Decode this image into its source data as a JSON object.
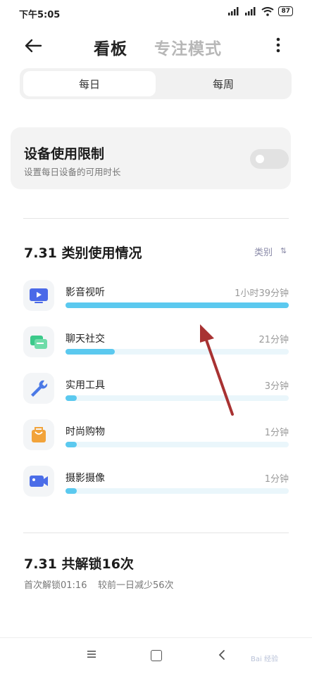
{
  "status_bar": {
    "time": "下午5:05",
    "battery": "87"
  },
  "header": {
    "tab_active": "看板",
    "tab_inactive": "专注模式"
  },
  "segment": {
    "daily": "每日",
    "weekly": "每周"
  },
  "limit_card": {
    "title": "设备使用限制",
    "subtitle": "设置每日设备的可用时长",
    "toggle_on": false
  },
  "category_section": {
    "title": "7.31 类别使用情况",
    "sort_label": "类别",
    "items": [
      {
        "name": "影音视听",
        "time": "1小时39分钟",
        "progress": 1.0,
        "icon": "video-icon",
        "color": "#4a69e8"
      },
      {
        "name": "聊天社交",
        "time": "21分钟",
        "progress": 0.22,
        "icon": "chat-icon",
        "color": "#3bc98a"
      },
      {
        "name": "实用工具",
        "time": "3分钟",
        "progress": 0.05,
        "icon": "wrench-icon",
        "color": "#4b79e6"
      },
      {
        "name": "时尚购物",
        "time": "1分钟",
        "progress": 0.05,
        "icon": "shopping-bag-icon",
        "color": "#f2a33a"
      },
      {
        "name": "摄影摄像",
        "time": "1分钟",
        "progress": 0.05,
        "icon": "camera-icon",
        "color": "#4b6de8"
      }
    ]
  },
  "unlock_section": {
    "title": "7.31 共解锁16次",
    "first_unlock": "首次解锁01:16",
    "comparison": "较前一日减少56次"
  },
  "watermark": "Bai 经验",
  "colors": {
    "accent": "#5bc9ef",
    "arrow": "#a83232"
  }
}
